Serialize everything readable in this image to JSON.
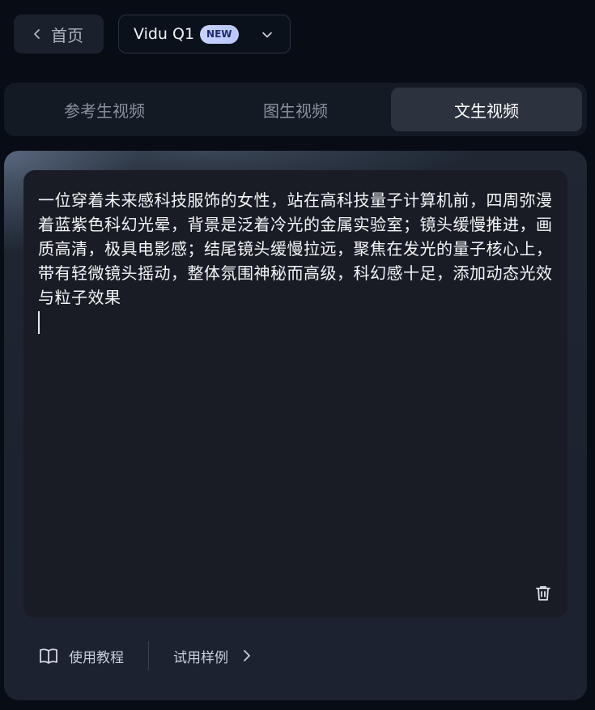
{
  "header": {
    "home_label": "首页",
    "model": {
      "name": "Vidu Q1",
      "badge": "NEW"
    }
  },
  "tabs": [
    {
      "label": "参考生视频",
      "active": false
    },
    {
      "label": "图生视频",
      "active": false
    },
    {
      "label": "文生视频",
      "active": true
    }
  ],
  "editor": {
    "prompt": "一位穿着未来感科技服饰的女性，站在高科技量子计算机前，四周弥漫着蓝紫色科幻光晕，背景是泛着冷光的金属实验室；镜头缓慢推进，画质高清，极具电影感；结尾镜头缓慢拉远，聚焦在发光的量子核心上，带有轻微镜头摇动，整体氛围神秘而高级，科幻感十足，添加动态光效与粒子效果"
  },
  "footer": {
    "tutorial_label": "使用教程",
    "examples_label": "试用样例"
  },
  "icons": {
    "home_back": "chevron-left-icon",
    "model_dropdown": "chevron-down-icon",
    "delete": "trash-icon",
    "tutorial": "book-icon",
    "examples": "chevron-right-icon"
  },
  "colors": {
    "background": "#080d15",
    "tab_active_bg": "#2c333f",
    "editor_bg": "#191c24",
    "badge_bg": "#c8d2ff",
    "badge_text": "#1d2a6b"
  }
}
